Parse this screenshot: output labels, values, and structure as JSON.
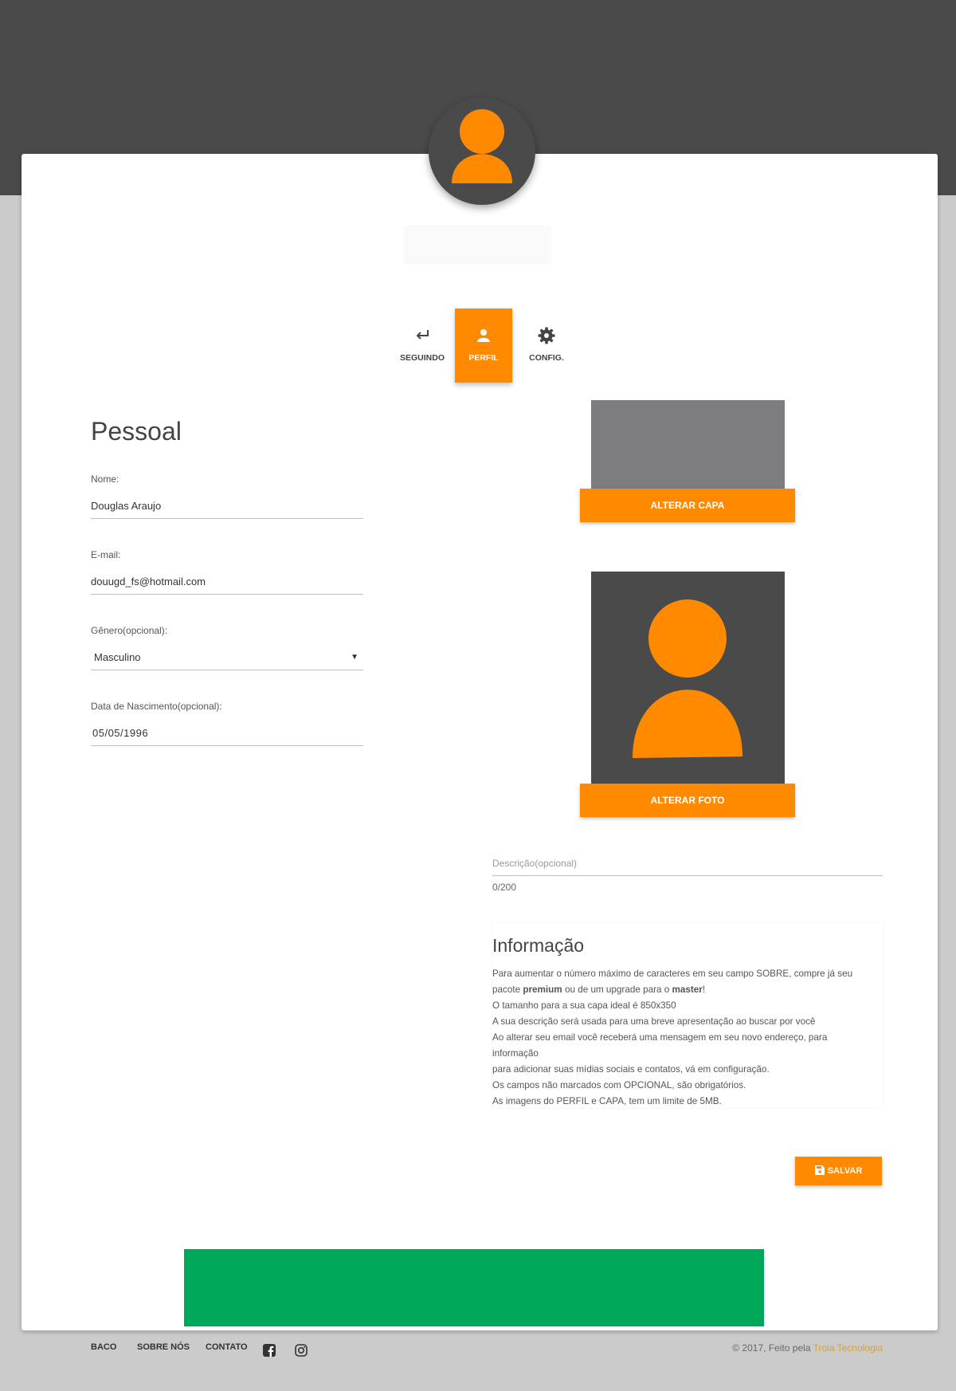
{
  "tabs": [
    {
      "label": "SEGUINDO",
      "icon": "return-arrow-icon"
    },
    {
      "label": "PERFIL",
      "icon": "person-icon"
    },
    {
      "label": "CONFIG.",
      "icon": "gear-icon"
    }
  ],
  "personal": {
    "title": "Pessoal",
    "name_label": "Nome:",
    "name_value": "Douglas Araujo",
    "email_label": "E-mail:",
    "email_value": "douugd_fs@hotmail.com",
    "gender_label": "Gênero(opcional):",
    "gender_value": "Masculino",
    "birth_label": "Data de Nascimento(opcional):",
    "birth_value": "05/05/1996"
  },
  "media": {
    "cover_button": "ALTERAR CAPA",
    "photo_button": "ALTERAR FOTO"
  },
  "description": {
    "placeholder": "Descrição(opcional)",
    "counter": "0/200"
  },
  "info": {
    "title": "Informação",
    "line1_a": "Para aumentar o número máximo de caracteres em seu campo SOBRE, compre já seu",
    "line2_a": "pacote ",
    "line2_b": "premium",
    "line2_c": " ou de um upgrade para o ",
    "line2_d": "master",
    "line2_e": "!",
    "line3": "O tamanho para a sua capa ideal é 850x350",
    "line4": "A sua descrição será usada para uma breve apresentação ao buscar por você",
    "line5": "Ao alterar seu email você receberá uma mensagem em seu novo endereço, para",
    "line6": "informação",
    "line7": "para adicionar suas mídias sociais e contatos, vá em configuração.",
    "line8": "Os campos não marcados com OPCIONAL, são obrigatórios.",
    "line9": "As imagens do PERFIL e CAPA, tem um limite de 5MB."
  },
  "save_button": "SALVAR",
  "footer": {
    "links": [
      "BACO",
      "SOBRE NÓS",
      "CONTATO"
    ],
    "social_icons": [
      "facebook-icon",
      "instagram-icon"
    ],
    "copyright_text": "© 2017, Feito pela ",
    "company": "Troia Tecnologia"
  },
  "colors": {
    "accent": "#ff8a00",
    "dark": "#4a4a4a",
    "page_bg": "#cbcbcb",
    "green": "#00a85a",
    "link": "#d2a23c"
  }
}
